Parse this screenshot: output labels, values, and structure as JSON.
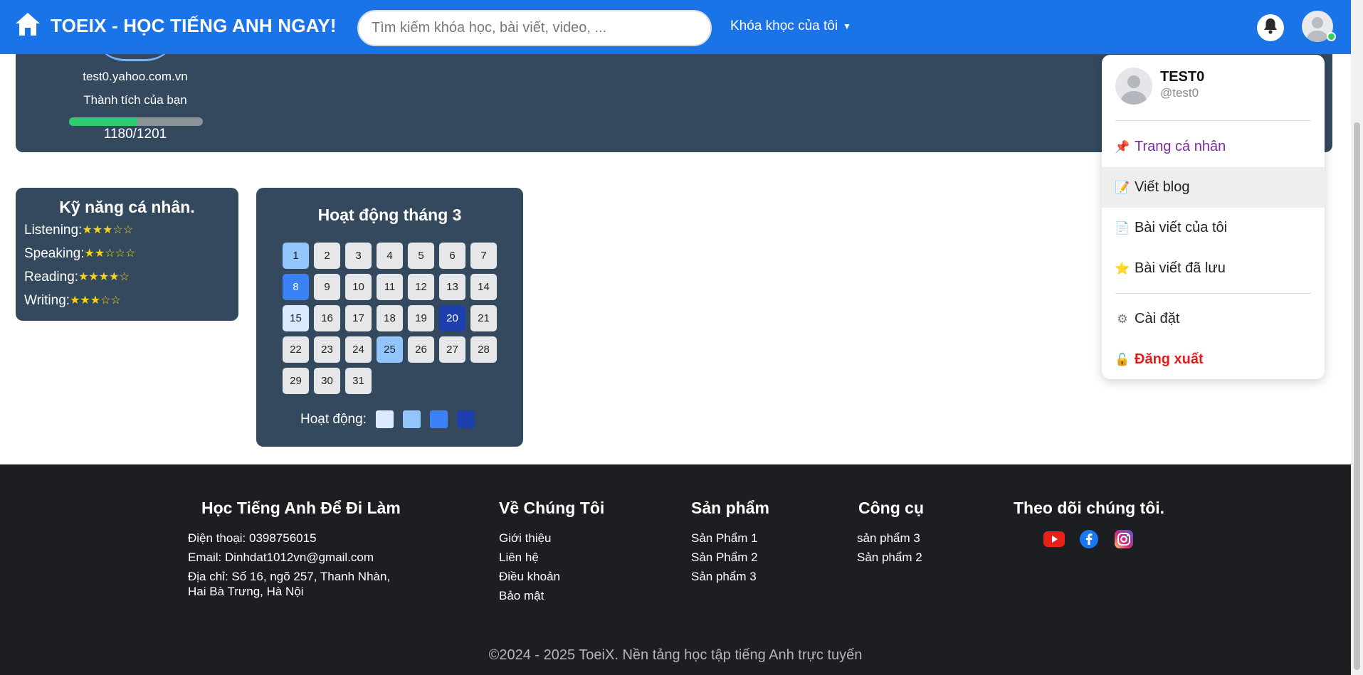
{
  "navbar": {
    "brand": "TOEIX - HỌC TIẾNG ANH NGAY!",
    "search_placeholder": "Tìm kiếm khóa học, bài viết, video, ...",
    "my_courses": "Khóa khọc của tôi"
  },
  "profile": {
    "email": "test0.yahoo.com.vn",
    "achievement_label": "Thành tích của bạn",
    "score": "1180/1201",
    "progress_fraction": 0.51
  },
  "skills": {
    "title": "Kỹ năng cá nhân.",
    "items": [
      {
        "label": "Listening:",
        "stars": "★★★☆☆"
      },
      {
        "label": "Speaking:",
        "stars": "★★☆☆☆"
      },
      {
        "label": "Reading:",
        "stars": "★★★★☆"
      },
      {
        "label": "Writing:",
        "stars": "★★★☆☆"
      }
    ]
  },
  "activity": {
    "title": "Hoạt động tháng 3",
    "days": [
      "1",
      "2",
      "3",
      "4",
      "5",
      "6",
      "7",
      "8",
      "9",
      "10",
      "11",
      "12",
      "13",
      "14",
      "15",
      "16",
      "17",
      "18",
      "19",
      "20",
      "21",
      "22",
      "23",
      "24",
      "25",
      "26",
      "27",
      "28",
      "29",
      "30",
      "31"
    ],
    "day_levels": [
      2,
      0,
      0,
      0,
      0,
      0,
      0,
      3,
      0,
      0,
      0,
      0,
      0,
      0,
      1,
      0,
      0,
      0,
      0,
      4,
      0,
      0,
      0,
      0,
      2,
      0,
      0,
      0,
      0,
      0,
      0
    ],
    "legend_label": "Hoạt động:",
    "level_colors": [
      "#e6e7e9",
      "#dbeafe",
      "#93c5fd",
      "#3b82f6",
      "#1e40af"
    ]
  },
  "dropdown": {
    "name": "TEST0",
    "handle": "@test0",
    "items": {
      "profile": "Trang cá nhân",
      "write_blog": "Viết blog",
      "my_posts": "Bài viết của tôi",
      "saved_posts": "Bài viết đã lưu",
      "settings": "Cài đặt",
      "logout": "Đăng xuất"
    }
  },
  "footer": {
    "col1": {
      "title": "Học Tiếng Anh Để Đi Làm",
      "phone": "Điện thoại: 0398756015",
      "email": "Email: Dinhdat1012vn@gmail.com",
      "address_1": "Địa chỉ: Số 16, ngõ 257, Thanh Nhàn,",
      "address_2": "Hai Bà Trưng, Hà Nội"
    },
    "col2": {
      "title": "Về Chúng Tôi",
      "links": [
        "Giới thiệu",
        "Liên hệ",
        "Điều khoản",
        "Bảo mật"
      ]
    },
    "col3": {
      "title": "Sản phẩm",
      "links": [
        "Sản Phẩm 1",
        "Sản Phẩm 2",
        "Sản phẩm 3"
      ]
    },
    "col4": {
      "title": "Công cụ",
      "links": [
        "sản phẩm 3",
        "Sản phẩm 2"
      ]
    },
    "col5": {
      "title": "Theo dõi chúng tôi."
    },
    "copyright": "©2024 - 2025 ToeiX. Nền tảng học tập tiếng Anh trực tuyến"
  }
}
